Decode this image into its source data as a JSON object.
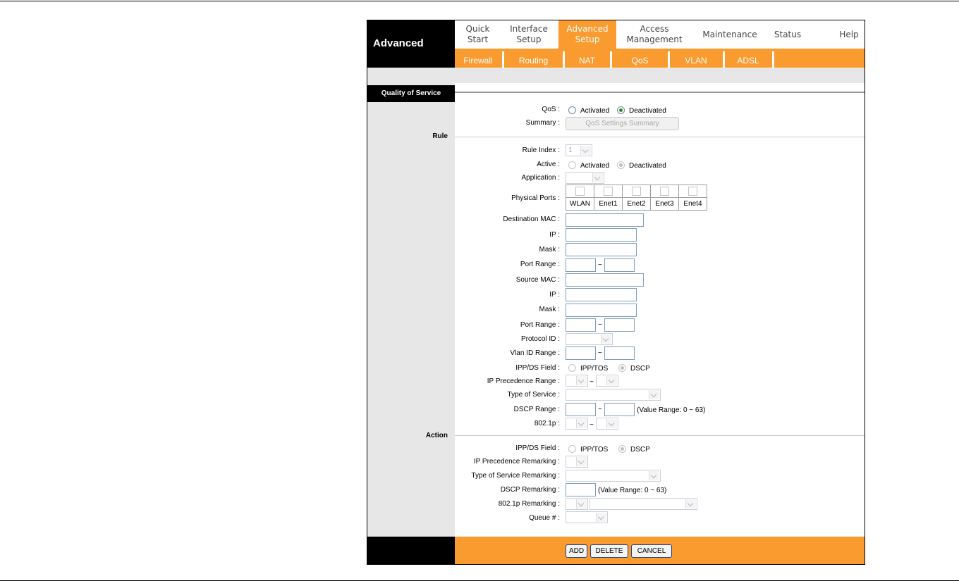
{
  "brand": "Advanced",
  "nav": {
    "tabs": [
      {
        "label": "Quick\nStart"
      },
      {
        "label": "Interface\nSetup"
      },
      {
        "label": "Advanced\nSetup"
      },
      {
        "label": "Access\nManagement"
      },
      {
        "label": "Maintenance"
      },
      {
        "label": "Status"
      },
      {
        "label": "Help"
      }
    ],
    "subtabs": [
      "Firewall",
      "Routing",
      "NAT",
      "QoS",
      "VLAN",
      "ADSL"
    ]
  },
  "section": {
    "title": "Quality of Service",
    "rule_label": "Rule",
    "action_label": "Action"
  },
  "qos": {
    "qos_label": "QoS :",
    "activated": "Activated",
    "deactivated": "Deactivated",
    "summary_label": "Summary :",
    "summary_button": "QoS Settings Summary"
  },
  "rule": {
    "rule_index_label": "Rule Index :",
    "rule_index_value": "1",
    "active_label": "Active :",
    "activated": "Activated",
    "deactivated": "Deactivated",
    "application_label": "Application :",
    "physical_ports_label": "Physical Ports :",
    "ports": [
      "WLAN",
      "Enet1",
      "Enet2",
      "Enet3",
      "Enet4"
    ],
    "dest_mac_label": "Destination MAC :",
    "ip_label": "IP :",
    "mask_label": "Mask :",
    "port_range_label": "Port Range :",
    "src_mac_label": "Source MAC :",
    "protocol_id_label": "Protocol ID :",
    "vlan_range_label": "Vlan ID Range :",
    "ippds_label": "IPP/DS Field :",
    "ipptos": "IPP/TOS",
    "dscp": "DSCP",
    "ip_prec_range_label": "IP Precedence Range :",
    "tos_label": "Type of Service :",
    "dscp_range_label": "DSCP Range :",
    "value_range_note": "(Value Range: 0 ~ 63)",
    "p8021_label": "802.1p :",
    "tilde": "~"
  },
  "action": {
    "ippds_label": "IPP/DS Field :",
    "ipptos": "IPP/TOS",
    "dscp": "DSCP",
    "ip_prec_remark_label": "IP Precedence Remarking :",
    "tos_remark_label": "Type of Service Remarking :",
    "dscp_remark_label": "DSCP Remarking :",
    "value_range_note": "(Value Range: 0 ~ 63)",
    "p8021_remark_label": "802.1p Remarking :",
    "queue_label": "Queue # :"
  },
  "footer": {
    "add": "ADD",
    "delete": "DELETE",
    "cancel": "CANCEL"
  },
  "colors": {
    "accent": "#f99b2f",
    "header_black": "#000000",
    "side_grey": "#e7e7e7"
  }
}
